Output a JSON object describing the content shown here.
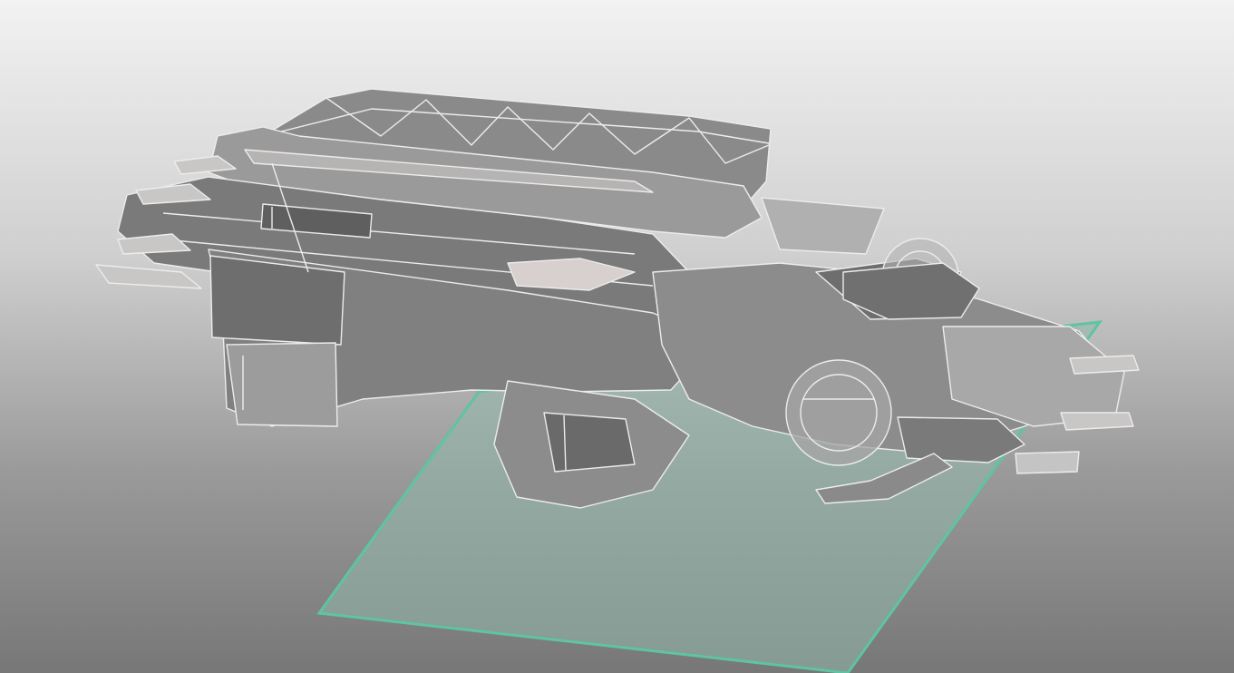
{
  "viewport": {
    "background_top": "#f2f2f2",
    "background_bottom": "#777777"
  },
  "model": {
    "icon": "wireframe-spaceship-icon",
    "shade_dark": "#6e6e6e",
    "shade_mid": "#8c8c8c",
    "shade_light": "#c9c6c6",
    "shade_pink": "#d8cfcf",
    "edge_color": "#ececec"
  },
  "ground_plane": {
    "icon": "grid-plane-icon",
    "border_color": "#5ec4a4",
    "fill_color": "#8fb8aa"
  }
}
